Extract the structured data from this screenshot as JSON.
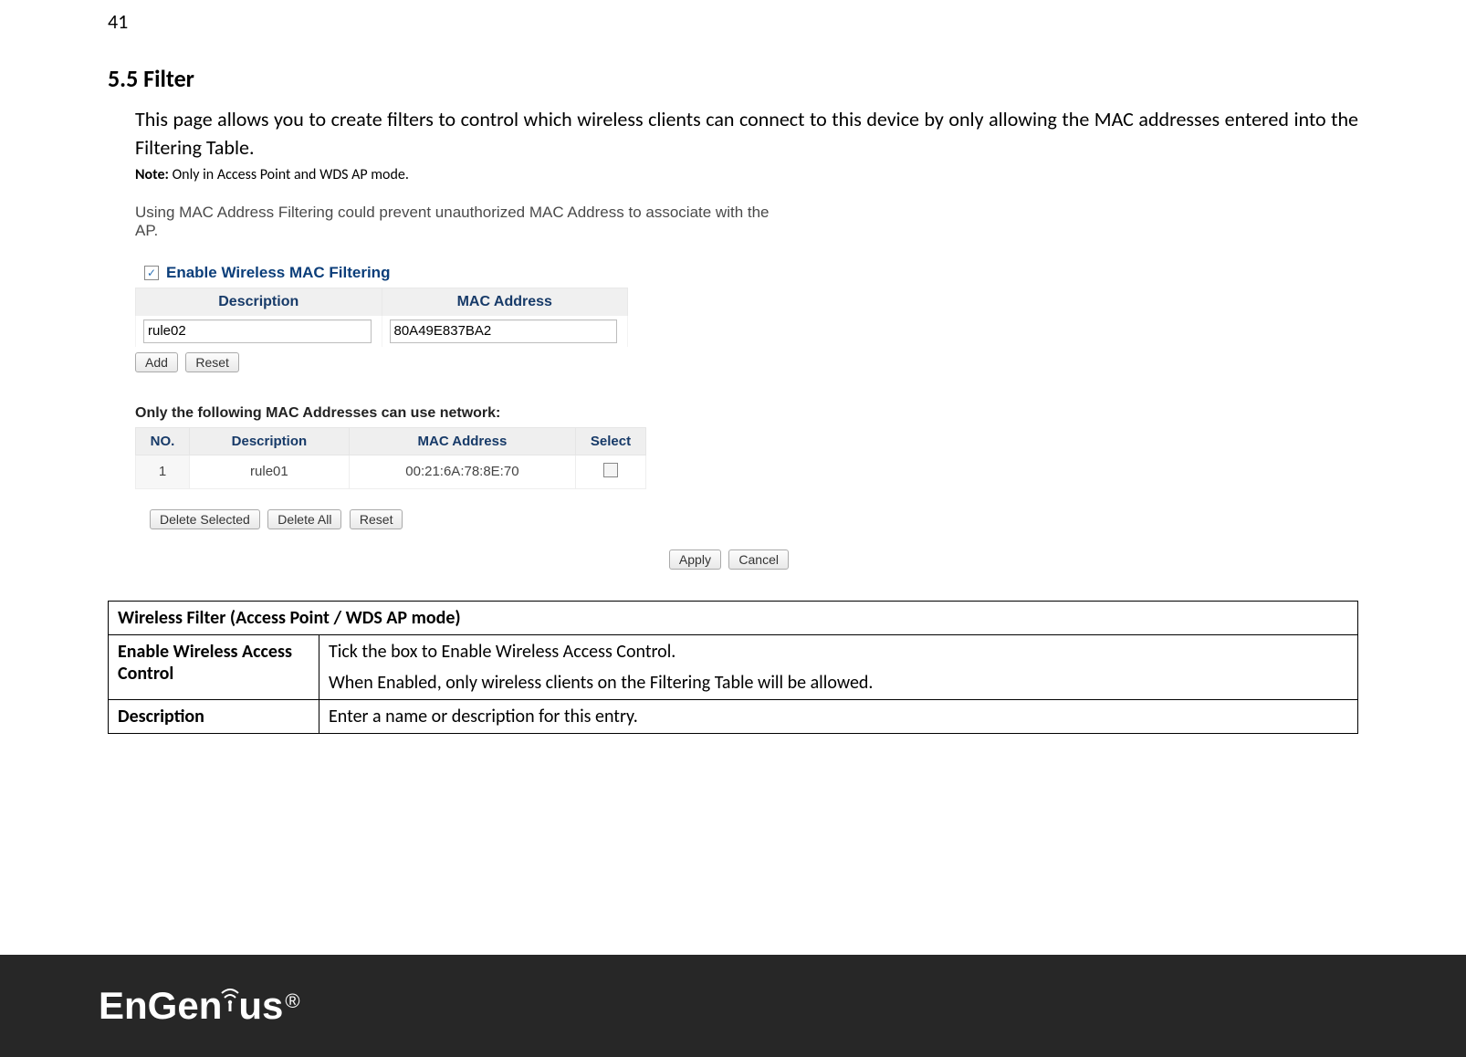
{
  "page_number": "41",
  "section_title": "5.5    Filter",
  "body_paragraph": "This page allows you to create filters to control which wireless clients can connect to this device by only allowing the MAC addresses entered into the Filtering Table.",
  "note_label": "Note:",
  "note_text": " Only in Access Point and WDS AP mode.",
  "screenshot": {
    "caption": "Using MAC Address Filtering could prevent unauthorized MAC Address to associate with the AP.",
    "checkbox_label": "Enable Wireless MAC Filtering",
    "header_description": "Description",
    "header_mac": "MAC Address",
    "input_description_value": "rule02",
    "input_mac_value": "80A49E837BA2",
    "btn_add": "Add",
    "btn_reset": "Reset",
    "subhead": "Only the following MAC Addresses can use network:",
    "col_no": "NO.",
    "col_desc": "Description",
    "col_mac": "MAC Address",
    "col_select": "Select",
    "rows": [
      {
        "no": "1",
        "desc": "rule01",
        "mac": "00:21:6A:78:8E:70"
      }
    ],
    "btn_delete_selected": "Delete Selected",
    "btn_delete_all": "Delete All",
    "btn_reset2": "Reset",
    "btn_apply": "Apply",
    "btn_cancel": "Cancel"
  },
  "desc_table": {
    "title": "Wireless Filter (Access Point / WDS AP mode)",
    "rows": [
      {
        "label": "Enable Wireless Access Control",
        "value_lines": [
          "Tick the box to Enable Wireless Access Control.",
          "When Enabled, only wireless clients on the Filtering Table will be allowed."
        ]
      },
      {
        "label": "Description",
        "value_lines": [
          "Enter a name or description for this entry."
        ]
      }
    ]
  },
  "logo_text_a": "EnGen",
  "logo_text_b": "us"
}
